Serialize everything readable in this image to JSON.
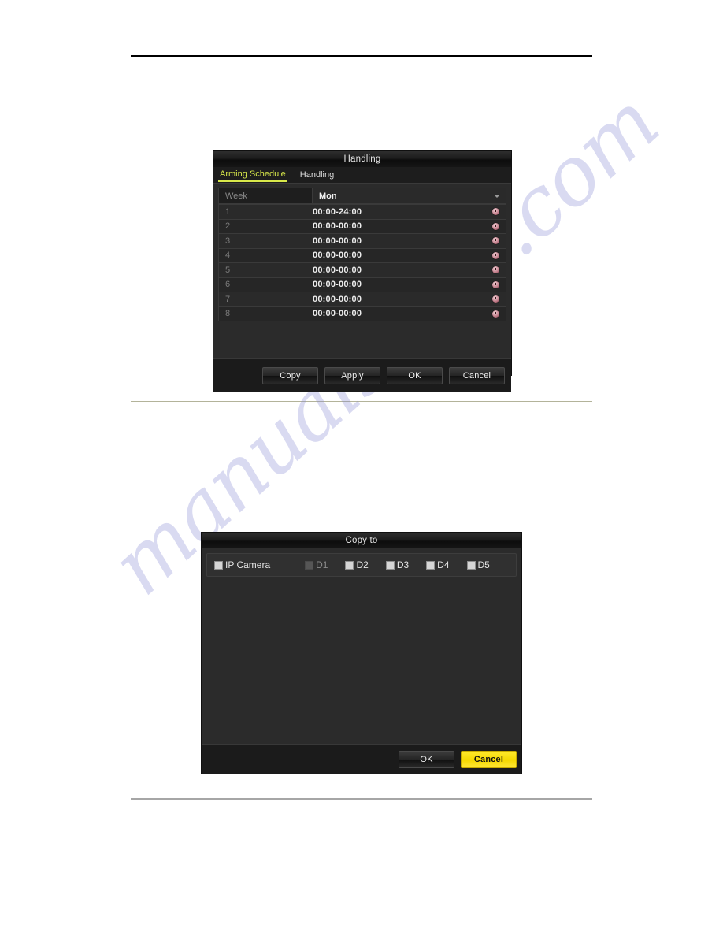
{
  "watermark": {
    "text": "manualshive.com"
  },
  "handling_dialog": {
    "title": "Handling",
    "tabs": [
      {
        "label": "Arming Schedule",
        "active": true
      },
      {
        "label": "Handling",
        "active": false
      }
    ],
    "week": {
      "label": "Week",
      "value": "Mon",
      "caret_icon": "chevron-down-icon"
    },
    "schedule_header": [
      "Week",
      "Mon"
    ],
    "schedule_rows": [
      {
        "index": "1",
        "time": "00:00-24:00",
        "icon": "clock-icon"
      },
      {
        "index": "2",
        "time": "00:00-00:00",
        "icon": "clock-icon"
      },
      {
        "index": "3",
        "time": "00:00-00:00",
        "icon": "clock-icon"
      },
      {
        "index": "4",
        "time": "00:00-00:00",
        "icon": "clock-icon"
      },
      {
        "index": "5",
        "time": "00:00-00:00",
        "icon": "clock-icon"
      },
      {
        "index": "6",
        "time": "00:00-00:00",
        "icon": "clock-icon"
      },
      {
        "index": "7",
        "time": "00:00-00:00",
        "icon": "clock-icon"
      },
      {
        "index": "8",
        "time": "00:00-00:00",
        "icon": "clock-icon"
      }
    ],
    "buttons": [
      {
        "label": "Copy",
        "highlight": false
      },
      {
        "label": "Apply",
        "highlight": false
      },
      {
        "label": "OK",
        "highlight": false
      },
      {
        "label": "Cancel",
        "highlight": false
      }
    ]
  },
  "copy_to_dialog": {
    "title": "Copy to",
    "ip_camera": {
      "label": "IP Camera",
      "checked": false,
      "disabled": false
    },
    "channels": [
      {
        "label": "D1",
        "checked": false,
        "disabled": true
      },
      {
        "label": "D2",
        "checked": false,
        "disabled": false
      },
      {
        "label": "D3",
        "checked": false,
        "disabled": false
      },
      {
        "label": "D4",
        "checked": false,
        "disabled": false
      },
      {
        "label": "D5",
        "checked": false,
        "disabled": false
      }
    ],
    "buttons": [
      {
        "label": "OK",
        "highlight": false
      },
      {
        "label": "Cancel",
        "highlight": true
      }
    ]
  },
  "colors": {
    "accent_tab": "#d8e84a",
    "highlight_button": "#f5d800",
    "dialog_bg": "#2b2b2b",
    "watermark": "#8284d2"
  }
}
